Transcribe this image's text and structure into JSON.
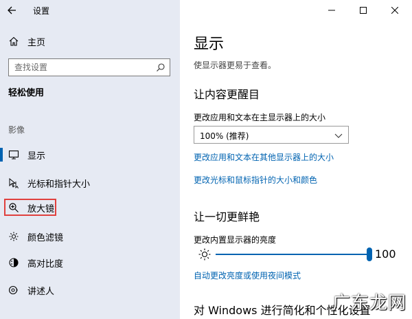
{
  "window": {
    "title": "设置"
  },
  "sidebar": {
    "home_label": "主页",
    "search_placeholder": "查找设置",
    "category": "轻松使用",
    "section_label": "影像",
    "items": [
      {
        "label": "显示",
        "icon": "monitor-icon",
        "selected": true
      },
      {
        "label": "光标和指针大小",
        "icon": "cursor-icon",
        "selected": false
      },
      {
        "label": "放大镜",
        "icon": "magnifier-icon",
        "selected": false,
        "highlighted": true
      },
      {
        "label": "颜色滤镜",
        "icon": "color-filter-icon",
        "selected": false
      },
      {
        "label": "高对比度",
        "icon": "contrast-icon",
        "selected": false
      },
      {
        "label": "讲述人",
        "icon": "narrator-icon",
        "selected": false
      }
    ]
  },
  "main": {
    "title": "显示",
    "description": "使显示器更易于查看。",
    "section1": {
      "heading": "让内容更醒目",
      "size_label": "更改应用和文本在主显示器上的大小",
      "size_value": "100% (推荐)",
      "link1": "更改应用和文本在其他显示器上的大小",
      "link2": "更改光标和鼠标指针的大小和颜色"
    },
    "section2": {
      "heading": "让一切更鲜艳",
      "brightness_label": "更改内置显示器的亮度",
      "brightness_value": "100",
      "brightness_level": 1.0,
      "link": "自动更改亮度或使用夜间模式"
    },
    "section3": {
      "heading": "对 Windows 进行简化和个性化设置"
    }
  },
  "watermark": {
    "text": "广东龙网"
  },
  "colors": {
    "sidebar_bg": "#e6eaf3",
    "accent": "#0063b1",
    "highlight": "#e0403d"
  }
}
